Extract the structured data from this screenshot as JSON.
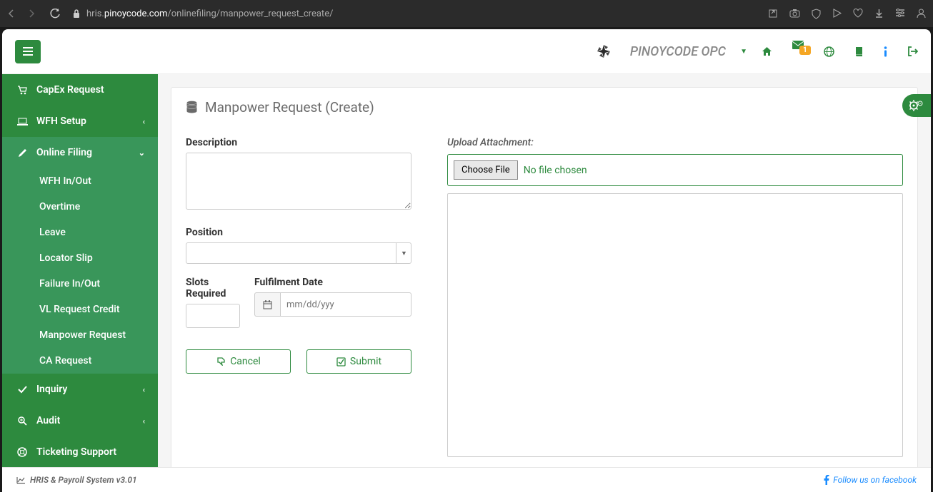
{
  "browser": {
    "url_prefix": "hris.",
    "url_domain": "pinoycode.com",
    "url_path": "/onlinefiling/manpower_request_create/"
  },
  "header": {
    "company": "PINOYCODE OPC",
    "notification_badge": "1"
  },
  "sidebar": {
    "items": [
      {
        "icon": "cart",
        "label": "CapEx Request",
        "has_chev": false
      },
      {
        "icon": "laptop",
        "label": "WFH Setup",
        "has_chev": true
      },
      {
        "icon": "pencil",
        "label": "Online Filing",
        "has_chev": true,
        "expanded": true,
        "children": [
          "WFH In/Out",
          "Overtime",
          "Leave",
          "Locator Slip",
          "Failure In/Out",
          "VL Request Credit",
          "Manpower Request",
          "CA Request"
        ]
      },
      {
        "icon": "check",
        "label": "Inquiry",
        "has_chev": true
      },
      {
        "icon": "zoom",
        "label": "Audit",
        "has_chev": true
      },
      {
        "icon": "life-ring",
        "label": "Ticketing Support",
        "has_chev": false
      }
    ]
  },
  "page": {
    "title": "Manpower Request (Create)",
    "form": {
      "description_label": "Description",
      "position_label": "Position",
      "slots_label": "Slots Required",
      "fulfilment_label": "Fulfilment Date",
      "date_placeholder": "mm/dd/yyy",
      "cancel_label": "Cancel",
      "submit_label": "Submit",
      "upload_label": "Upload Attachment:",
      "choose_file_label": "Choose File",
      "no_file_label": "No file chosen"
    }
  },
  "footer": {
    "version": "HRIS & Payroll System v3.01",
    "facebook": "Follow us on facebook"
  }
}
